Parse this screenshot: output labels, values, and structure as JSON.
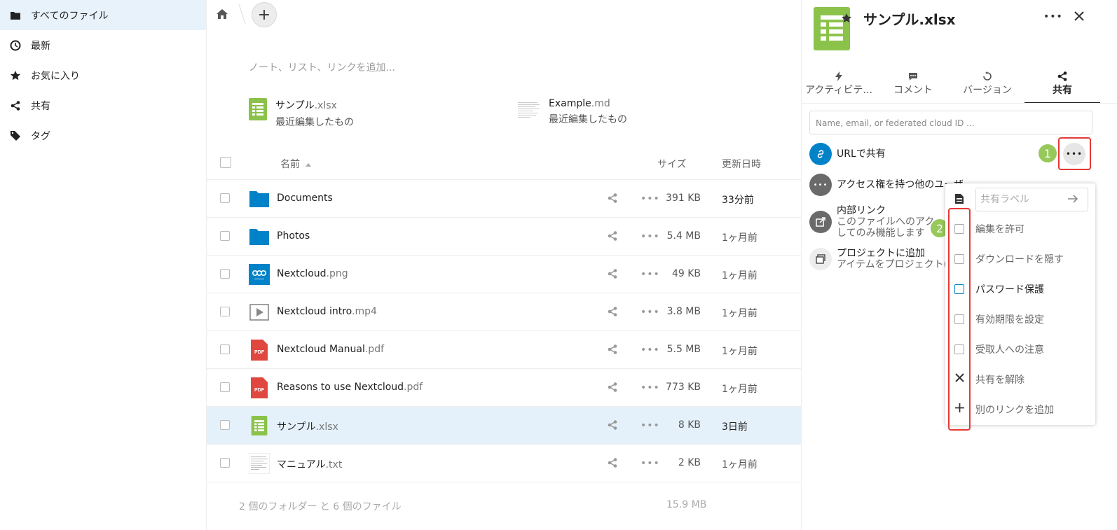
{
  "sidebar": {
    "items": [
      {
        "label": "すべてのファイル",
        "icon": "folder-icon"
      },
      {
        "label": "最新",
        "icon": "clock-icon"
      },
      {
        "label": "お気に入り",
        "icon": "star-icon"
      },
      {
        "label": "共有",
        "icon": "share-icon"
      },
      {
        "label": "タグ",
        "icon": "tag-icon"
      }
    ]
  },
  "main": {
    "add_label": "+",
    "note_placeholder": "ノート、リスト、リンクを追加...",
    "recent": [
      {
        "name": "サンプル",
        "ext": ".xlsx",
        "sub": "最近編集したもの"
      },
      {
        "name": "Example",
        "ext": ".md",
        "sub": "最近編集したもの"
      }
    ],
    "columns": {
      "name": "名前",
      "size": "サイズ",
      "date": "更新日時"
    },
    "rows": [
      {
        "name": "Documents",
        "ext": "",
        "size": "391 KB",
        "date": "33分前"
      },
      {
        "name": "Photos",
        "ext": "",
        "size": "5.4 MB",
        "date": "1ヶ月前"
      },
      {
        "name": "Nextcloud",
        "ext": ".png",
        "size": "49 KB",
        "date": "1ヶ月前"
      },
      {
        "name": "Nextcloud intro",
        "ext": ".mp4",
        "size": "3.8 MB",
        "date": "1ヶ月前"
      },
      {
        "name": "Nextcloud Manual",
        "ext": ".pdf",
        "size": "5.5 MB",
        "date": "1ヶ月前"
      },
      {
        "name": "Reasons to use Nextcloud",
        "ext": ".pdf",
        "size": "773 KB",
        "date": "1ヶ月前"
      },
      {
        "name": "サンプル",
        "ext": ".xlsx",
        "size": "8 KB",
        "date": "3日前"
      },
      {
        "name": "マニュアル",
        "ext": ".txt",
        "size": "2 KB",
        "date": "1ヶ月前"
      }
    ],
    "summary": "2 個のフォルダー と 6 個のファイル",
    "summary_size": "15.9 MB"
  },
  "panel": {
    "title": "サンプル.xlsx",
    "tabs": [
      "アクティビテ...",
      "コメント",
      "バージョン",
      "共有"
    ],
    "share_input_placeholder": "Name, email, or federated cloud ID ...",
    "share_url": "URLで共有",
    "others_access": "アクセス権を持つ他のユーザ",
    "internal_link_title": "内部リンク",
    "internal_link_desc1": "このファイルへのアク",
    "internal_link_desc2": "してのみ機能します",
    "project_title": "プロジェクトに追加",
    "project_desc": "アイテムをプロジェクト(",
    "badge1": "1",
    "badge2": "2"
  },
  "popup": {
    "label_placeholder": "共有ラベル",
    "items": [
      "編集を許可",
      "ダウンロードを隠す",
      "パスワード保護",
      "有効期限を設定",
      "受取人への注意",
      "共有を解除",
      "別のリンクを追加"
    ]
  },
  "colors": {
    "accent": "#0082c9",
    "xlsx": "#8bc34a",
    "pdf": "#e0473e",
    "badge": "#8bc34a",
    "highlight": "#e53935"
  }
}
